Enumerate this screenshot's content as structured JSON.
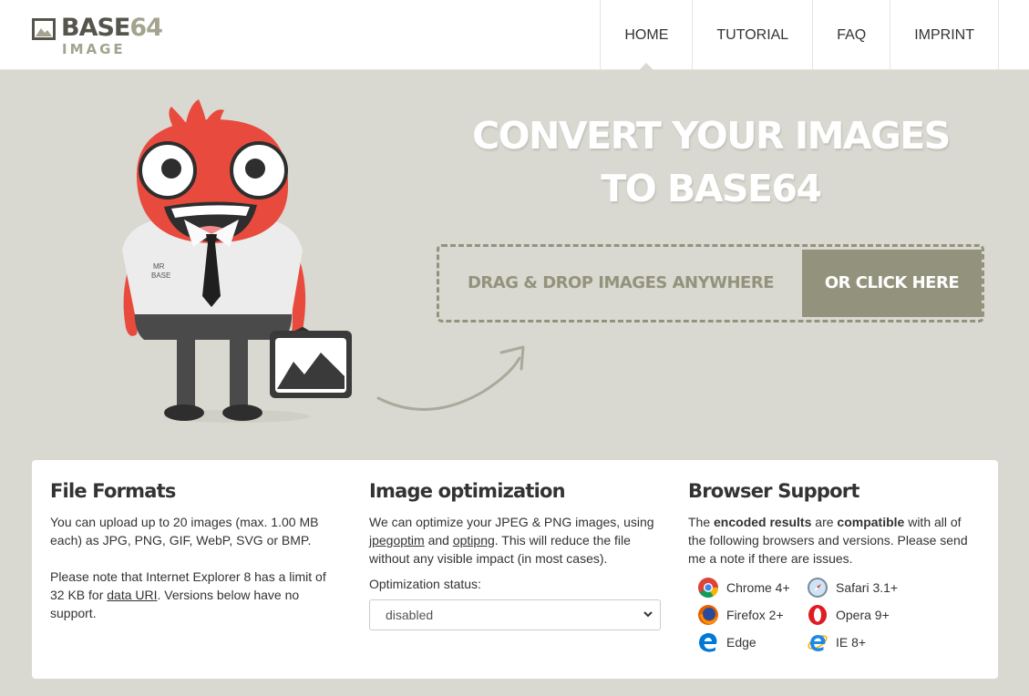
{
  "header": {
    "logo_title_main": "BASE",
    "logo_title_num": "64",
    "logo_subtitle": "IMAGE",
    "nav": [
      {
        "label": "HOME"
      },
      {
        "label": "TUTORIAL"
      },
      {
        "label": "FAQ"
      },
      {
        "label": "IMPRINT"
      }
    ]
  },
  "hero": {
    "title_line1": "CONVERT YOUR IMAGES",
    "title_line2": "TO BASE64",
    "drop_text": "DRAG & DROP IMAGES ANYWHERE",
    "click_label": "OR CLICK HERE",
    "mascot_shirt_line1": "MR",
    "mascot_shirt_line2": "BASE"
  },
  "formats": {
    "title": "File Formats",
    "p1": "You can upload up to 20 images (max. 1.00 MB each) as JPG, PNG, GIF, WebP, SVG or BMP.",
    "p2_a": "Please note that Internet Explorer 8 has a limit of 32 KB for ",
    "p2_link": "data URI",
    "p2_b": ". Versions below have no support."
  },
  "optimization": {
    "title": "Image optimization",
    "p_a": "We can optimize your JPEG & PNG images, using ",
    "link1": "jpegoptim",
    "p_and": " and ",
    "link2": "optipng",
    "p_b": ". This will reduce the file without any visible impact (in most cases).",
    "status_label": "Optimization status:",
    "status_value": "disabled"
  },
  "support": {
    "title": "Browser Support",
    "p_a": "The ",
    "bold1": "encoded results",
    "p_b": " are ",
    "bold2": "compatible",
    "p_c": " with all of the following browsers and versions. Please send me a note if there are issues.",
    "browsers": [
      {
        "label": "Chrome 4+",
        "icon": "chrome-icon"
      },
      {
        "label": "Safari 3.1+",
        "icon": "safari-icon"
      },
      {
        "label": "Firefox 2+",
        "icon": "firefox-icon"
      },
      {
        "label": "Opera 9+",
        "icon": "opera-icon"
      },
      {
        "label": "Edge",
        "icon": "edge-icon"
      },
      {
        "label": "IE 8+",
        "icon": "ie-icon"
      }
    ]
  },
  "colors": {
    "background": "#d9d9d1",
    "accent": "#93937d",
    "mascot": "#e84b3d"
  }
}
